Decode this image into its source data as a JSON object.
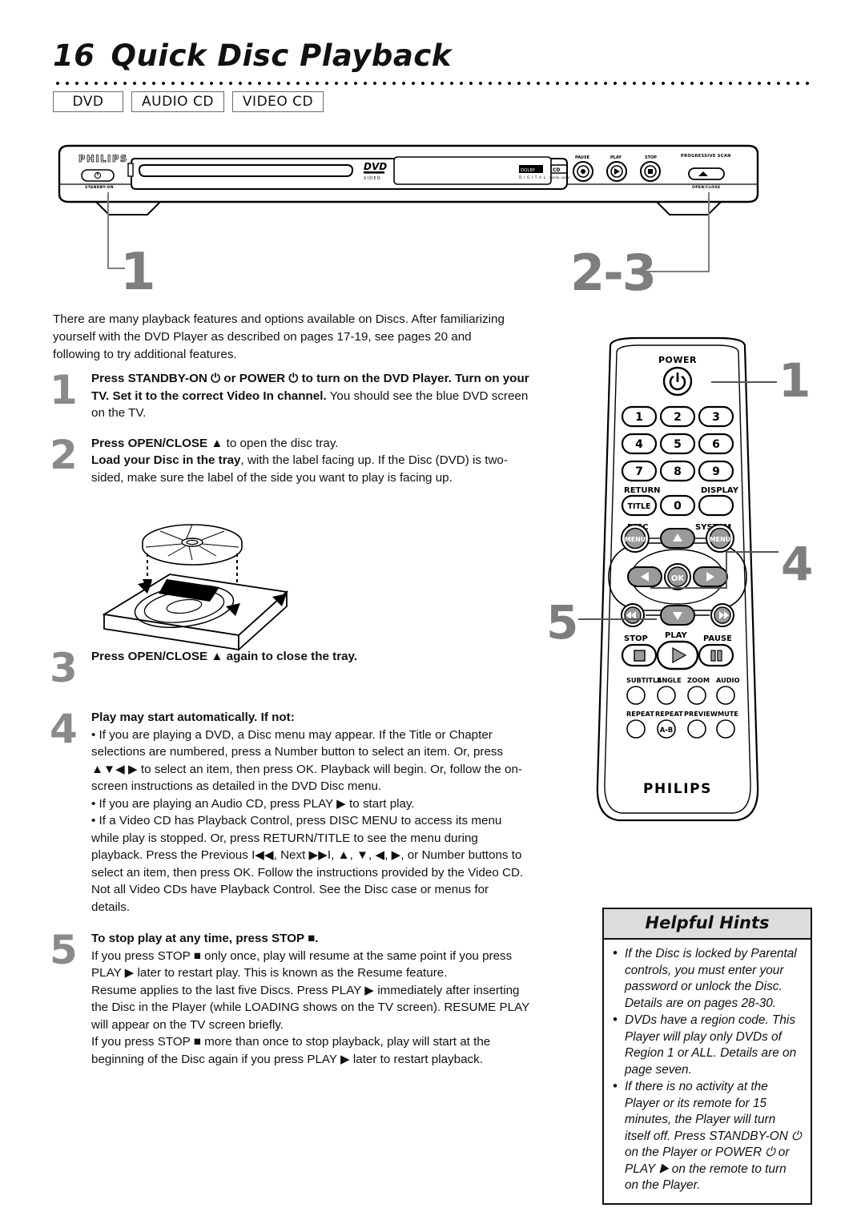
{
  "header": {
    "page_number": "16",
    "title": "Quick Disc Playback"
  },
  "disc_tabs": [
    {
      "label": "DVD"
    },
    {
      "label": "AUDIO CD"
    },
    {
      "label": "VIDEO CD"
    }
  ],
  "callouts": {
    "player_left": "1",
    "player_right": "2-3",
    "remote_power": "1",
    "remote_navigation": "4",
    "remote_transport": "5"
  },
  "player": {
    "brand": "PHILIPS",
    "standby_label": "STANDBY-ON",
    "open_close_label": "OPEN/CLOSE",
    "progressive_scan_label": "PROGRESSIVE SCAN",
    "dvd_logo_top": "DVD",
    "dvd_logo_bottom": "VIDEO",
    "dolby_top": "DOLBY",
    "dolby_bottom": "D I G I T A L",
    "cd_logo_top": "CD",
    "cd_logo_bottom": "DIGITAL AUDIO",
    "front_buttons": [
      {
        "label": "PAUSE"
      },
      {
        "label": "PLAY"
      },
      {
        "label": "STOP"
      }
    ]
  },
  "intro": "There are many playback features and options available on Discs. After familiarizing yourself with the DVD Player as described on pages 17-19, see pages 20 and following to try additional features.",
  "steps": [
    {
      "number": "1",
      "lead": "Press STANDBY-ON ⏻ or POWER ⏻ to turn on the DVD Player. Turn on your TV.  Set it to the correct Video In channel.",
      "rest": " You should see the blue DVD screen on the TV."
    },
    {
      "number": "2",
      "lead": "Press OPEN/CLOSE ▲",
      "rest": " to open the disc tray.",
      "lead2": "Load your Disc in the tray",
      "rest2": ", with the label facing up. If the Disc (DVD) is two-sided, make sure the label of the side you want to play is facing up."
    },
    {
      "number": "3",
      "lead": "Press OPEN/CLOSE ▲ again to close the tray.",
      "rest": ""
    },
    {
      "number": "4",
      "lead": "Play may start automatically. If not:",
      "bullets": [
        "If you are playing a DVD, a Disc menu may appear. If the Title or Chapter selections are numbered, press a Number button to select an item. Or, press ▲▼◀ ▶ to select an item, then press OK. Playback will begin. Or, follow the on-screen instructions as detailed in the DVD Disc menu.",
        "If you are playing an Audio CD, press PLAY ▶ to start play.",
        "If a Video CD has Playback Control, press DISC MENU to access its menu while play is stopped. Or, press RETURN/TITLE to see the menu during playback.  Press the Previous I◀◀, Next ▶▶I, ▲, ▼, ◀, ▶, or Number buttons to select an item, then press OK. Follow the instructions provided by the Video CD. Not all Video CDs have Playback Control. See the Disc case or menus for details."
      ]
    },
    {
      "number": "5",
      "lead": "To stop play at any time, press STOP ■.",
      "paragraphs": [
        "If you press STOP ■ only once, play will resume at the same point if you press PLAY ▶ later to restart play. This is known as the Resume feature.",
        "Resume applies to the last five Discs. Press PLAY ▶ immediately after inserting the Disc in the Player (while LOADING shows on the TV screen). RESUME PLAY will appear on the TV screen briefly.",
        "If you press STOP ■ more than once to stop playback, play will start at the beginning of the Disc again if you press PLAY ▶ later to restart playback."
      ]
    }
  ],
  "remote": {
    "brand": "PHILIPS",
    "power_label": "POWER",
    "number_keys": [
      "1",
      "2",
      "3",
      "4",
      "5",
      "6",
      "7",
      "8",
      "9"
    ],
    "zero_key": "0",
    "return_label": "RETURN",
    "title_label": "TITLE",
    "display_label": "DISPLAY",
    "disc_label": "DISC",
    "disc_menu_label": "MENU",
    "system_label": "SYSTEM",
    "system_menu_label": "MENU",
    "ok_label": "OK",
    "stop_label": "STOP",
    "play_label": "PLAY",
    "pause_label": "PAUSE",
    "feature_row_1": [
      "SUBTITLE",
      "ANGLE",
      "ZOOM",
      "AUDIO"
    ],
    "feature_row_2": [
      "REPEAT",
      "REPEAT",
      "PREVIEW",
      "MUTE"
    ],
    "repeat_ab_label": "A-B"
  },
  "hints": {
    "title": "Helpful Hints",
    "items": [
      "If the Disc is locked by Parental controls, you must enter your password or unlock the Disc. Details are on pages 28-30.",
      "DVDs have a region code. This Player will play only DVDs of Region 1 or ALL. Details are on page seven.",
      "If there is no activity at the Player or its remote for 15 minutes, the Player will turn itself off. Press STANDBY-ON ⏻ on the Player or POWER ⏻ or PLAY ▶ on the remote to turn on the Player."
    ]
  }
}
